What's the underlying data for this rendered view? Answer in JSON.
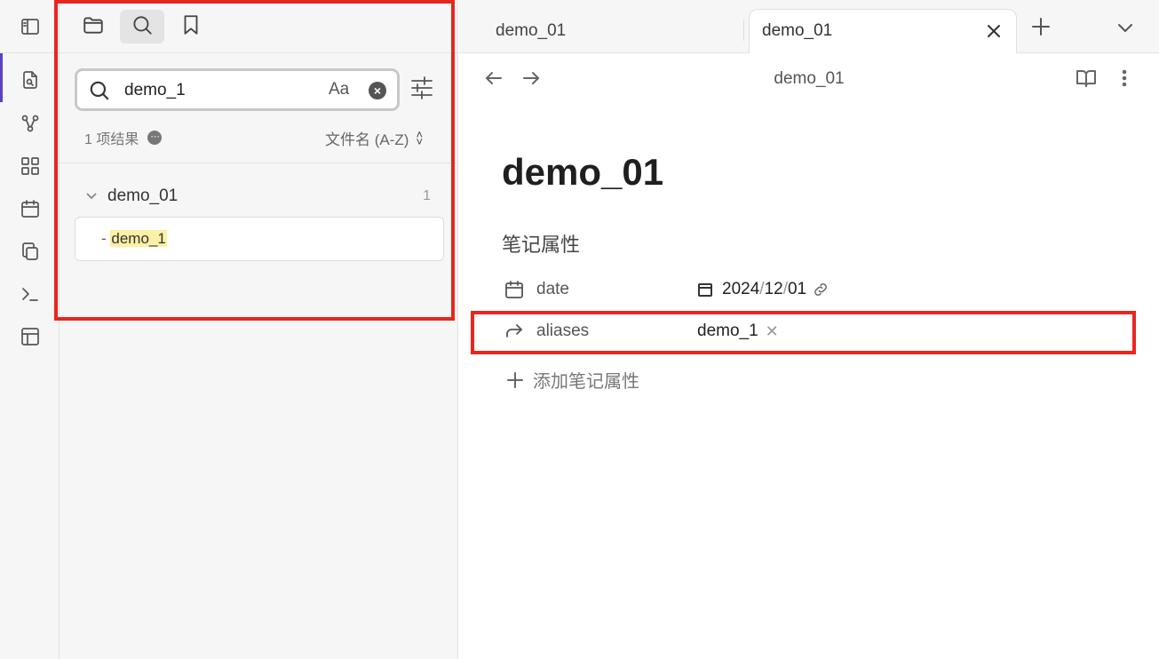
{
  "ribbon": {
    "icons": [
      "sidebar-toggle-icon",
      "file-search-icon",
      "graph-icon",
      "blocks-icon",
      "calendar-icon",
      "copy-icon",
      "terminal-icon",
      "layout-icon"
    ]
  },
  "side_panel": {
    "tabs": [
      "folder-icon",
      "search-icon",
      "bookmark-icon"
    ],
    "search": {
      "value": "demo_1",
      "placeholder": "",
      "match_case_label": "Aa"
    },
    "result_count": "1 项结果",
    "sort_label": "文件名 (A-Z)",
    "results": [
      {
        "file": "demo_01",
        "count": "1",
        "match_prefix": "- ",
        "match_highlight": "demo_1"
      }
    ]
  },
  "main": {
    "tabs": [
      {
        "label": "demo_01",
        "active": false
      },
      {
        "label": "demo_01",
        "active": true
      }
    ],
    "view_title": "demo_01",
    "note_title": "demo_01",
    "properties_heading": "笔记属性",
    "properties": [
      {
        "icon": "calendar-icon",
        "key": "date",
        "value_year": "2024",
        "value_month": "12",
        "value_day": "01"
      },
      {
        "icon": "forward-arrow-icon",
        "key": "aliases",
        "value": "demo_1"
      }
    ],
    "add_property_label": "添加笔记属性"
  },
  "colors": {
    "annotation_red": "#e8261e",
    "highlight_yellow": "#fbf0a6",
    "accent_purple": "#5b3fc5"
  }
}
